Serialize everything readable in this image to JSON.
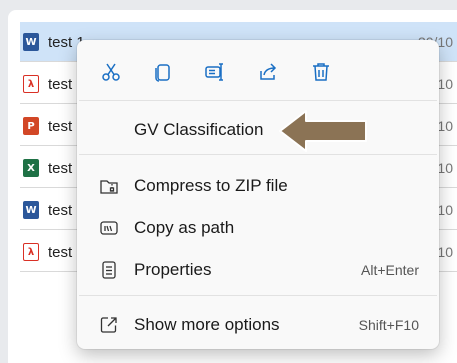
{
  "files": [
    {
      "name": "test 1",
      "type": "word",
      "glyph": "W",
      "date": "30/10",
      "selected": true
    },
    {
      "name": "test",
      "type": "pdf",
      "glyph": "λ",
      "date": "10"
    },
    {
      "name": "test",
      "type": "ppt",
      "glyph": "P",
      "date": "10"
    },
    {
      "name": "test",
      "type": "xls",
      "glyph": "X",
      "date": "10"
    },
    {
      "name": "test",
      "type": "word",
      "glyph": "W",
      "date": "10"
    },
    {
      "name": "test",
      "type": "pdf",
      "glyph": "λ",
      "date": "10"
    }
  ],
  "toolbar": {
    "cut": "scissors-icon",
    "copy": "copy-icon",
    "rename": "rename-icon",
    "share": "share-icon",
    "delete": "trash-icon"
  },
  "menu": {
    "gv_classification": "GV Classification",
    "compress_zip": "Compress to ZIP file",
    "copy_as_path": "Copy as path",
    "properties": "Properties",
    "properties_shortcut": "Alt+Enter",
    "show_more": "Show more options",
    "show_more_shortcut": "Shift+F10"
  },
  "colors": {
    "accent": "#1a6fc4",
    "selection": "#cfe3f8",
    "annotation_arrow": "#8b7355"
  }
}
